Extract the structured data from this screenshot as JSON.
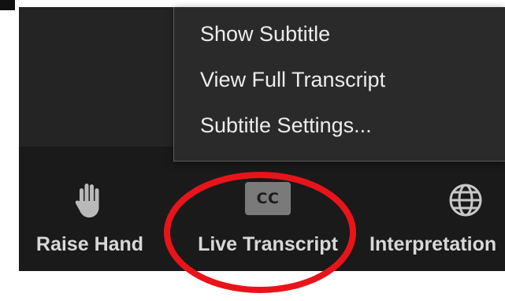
{
  "menu": {
    "items": [
      {
        "label": "Show Subtitle"
      },
      {
        "label": "View Full Transcript"
      },
      {
        "label": "Subtitle Settings..."
      }
    ]
  },
  "toolbar": {
    "raise_hand": {
      "label": "Raise Hand",
      "icon": "hand-icon"
    },
    "live_transcript": {
      "label": "Live Transcript",
      "icon": "cc-icon",
      "icon_text": "CC"
    },
    "interpretation": {
      "label": "Interpretation",
      "icon": "globe-icon"
    }
  },
  "colors": {
    "toolbar_bg": "#1a1a1a",
    "menu_bg": "#2a2a2a",
    "text": "#ececec",
    "annotation": "#e8141a"
  }
}
